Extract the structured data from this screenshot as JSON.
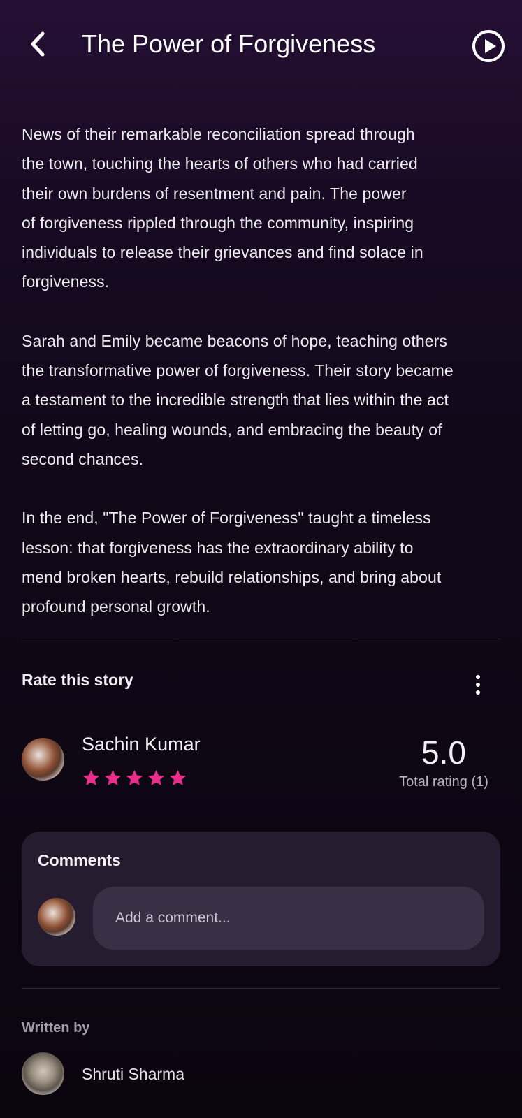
{
  "header": {
    "title": "The Power of Forgiveness",
    "back_icon": "chevron-left-icon",
    "play_icon": "play-circle-icon"
  },
  "story": {
    "paragraphs": [
      "News of their remarkable reconciliation spread through\nthe town, touching the hearts of others who had carried\ntheir own burdens of resentment and pain. The power\nof forgiveness rippled through the community, inspiring\nindividuals to release their grievances and find solace in\nforgiveness.",
      "Sarah and Emily became beacons of hope, teaching others\nthe transformative power of forgiveness. Their story became\na testament to the incredible strength that lies within the act\nof letting go, healing wounds, and embracing the beauty of\nsecond chances.",
      "In the end, \"The Power of Forgiveness\" taught a timeless\nlesson: that forgiveness has the extraordinary ability to\nmend broken hearts, rebuild relationships, and bring about\nprofound personal growth."
    ]
  },
  "rating": {
    "section_title": "Rate this story",
    "more_icon": "more-vertical-icon",
    "rater_name": "Sachin Kumar",
    "stars": 5,
    "max_stars": 5,
    "star_color": "#e8308a",
    "value": "5.0",
    "total_label": "Total rating (1)"
  },
  "comments": {
    "title": "Comments",
    "input_placeholder": "Add a comment..."
  },
  "author": {
    "label": "Written by",
    "name": "Shruti Sharma"
  }
}
